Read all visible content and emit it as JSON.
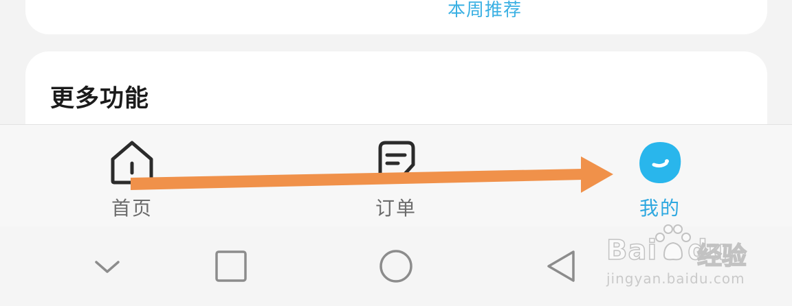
{
  "top_card": {
    "link_label": "本周推荐"
  },
  "more_section": {
    "title": "更多功能"
  },
  "tabbar": {
    "tabs": [
      {
        "label": "首页",
        "icon": "house-icon",
        "active": false
      },
      {
        "label": "订单",
        "icon": "order-document-icon",
        "active": false
      },
      {
        "label": "我的",
        "icon": "profile-avatar-icon",
        "active": true
      }
    ],
    "active_color": "#2ea8e0",
    "inactive_color": "#6b6b6b"
  },
  "system_nav": {
    "buttons": [
      "chevron-down-icon",
      "square-recents-icon",
      "circle-home-icon",
      "triangle-back-icon"
    ]
  },
  "annotation": {
    "type": "arrow",
    "color": "#f0914a",
    "points_to": "我的"
  },
  "watermark": {
    "brand": "Bai",
    "brand_suffix": "du",
    "product": "经验",
    "url": "jingyan.baidu.com"
  }
}
